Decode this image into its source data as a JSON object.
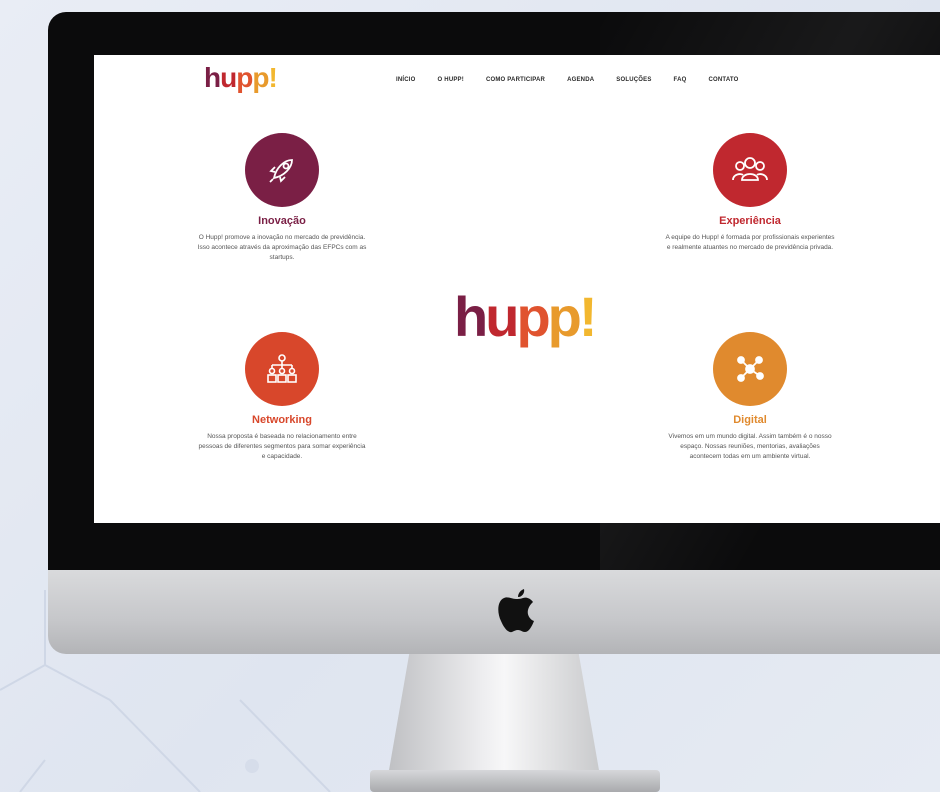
{
  "colors": {
    "purple": "#7a1f45",
    "red": "#c0282f",
    "orange_red": "#d8472b",
    "orange": "#e08a2e",
    "logo_h": "#7a1f45",
    "logo_u": "#c0282f",
    "logo_p1": "#e0532f",
    "logo_p2": "#e89a2c",
    "logo_bang": "#f2b72f"
  },
  "site": {
    "logo": {
      "h": "h",
      "u": "u",
      "p1": "p",
      "p2": "p",
      "bang": "!"
    },
    "nav": [
      "INÍCIO",
      "O HUPP!",
      "COMO PARTICIPAR",
      "AGENDA",
      "SOLUÇÕES",
      "FAQ",
      "CONTATO"
    ]
  },
  "features": {
    "inovacao": {
      "title": "Inovação",
      "icon": "rocket-icon",
      "desc": "O Hupp! promove a inovação no mercado de previdência. Isso acontece através da aproximação das EFPCs com as startups."
    },
    "experiencia": {
      "title": "Experiência",
      "icon": "people-icon",
      "desc": "A equipe do Hupp! é formada por profissionais experientes e realmente atuantes no mercado de previdência privada."
    },
    "networking": {
      "title": "Networking",
      "icon": "network-people-icon",
      "desc": "Nossa proposta é baseada no relacionamento entre pessoas de diferentes segmentos para somar experiência e capacidade."
    },
    "digital": {
      "title": "Digital",
      "icon": "share-nodes-icon",
      "desc": "Vivemos em um mundo digital. Assim também é o nosso espaço. Nossas reuniões, mentorias, avaliações acontecem todas em um ambiente virtual."
    }
  }
}
